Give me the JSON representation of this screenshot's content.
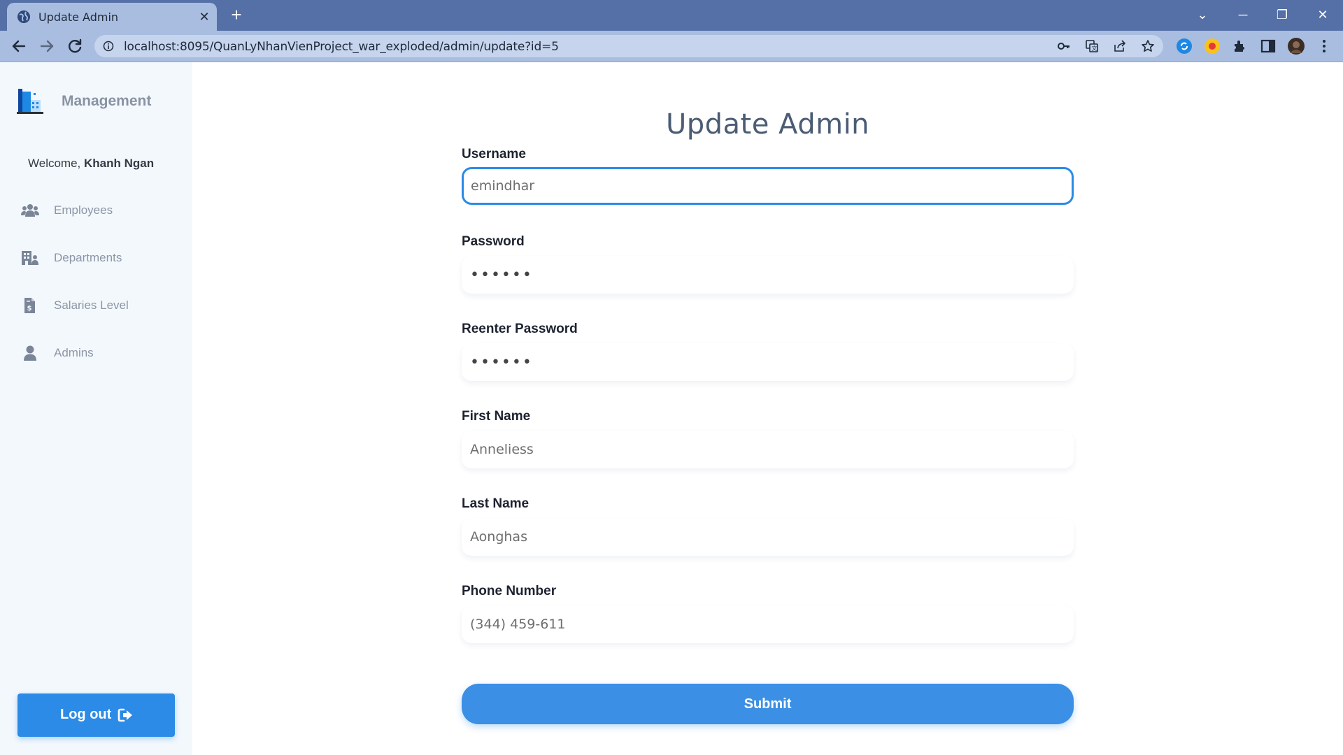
{
  "browser": {
    "tab_title": "Update Admin",
    "url": "localhost:8095/QuanLyNhanVienProject_war_exploded/admin/update?id=5",
    "icons": [
      "globe-icon",
      "close-icon",
      "plus-icon",
      "back-icon",
      "forward-icon",
      "reload-icon",
      "info-icon",
      "key-icon",
      "translate-icon",
      "share-icon",
      "star-icon",
      "extension-icon",
      "side-panel-icon",
      "avatar"
    ]
  },
  "sidebar": {
    "brand": "Management",
    "welcome_prefix": "Welcome, ",
    "welcome_name": "Khanh Ngan",
    "items": [
      {
        "label": "Employees",
        "icon": "users-icon"
      },
      {
        "label": "Departments",
        "icon": "building-icon"
      },
      {
        "label": "Salaries Level",
        "icon": "invoice-dollar-icon"
      },
      {
        "label": "Admins",
        "icon": "user-icon"
      }
    ],
    "logout_label": "Log out"
  },
  "form": {
    "title": "Update Admin",
    "fields": [
      {
        "label": "Username",
        "value": "emindhar"
      },
      {
        "label": "Password",
        "value": "••••••"
      },
      {
        "label": "Reenter Password",
        "value": "••••••"
      },
      {
        "label": "First Name",
        "value": "Anneliess"
      },
      {
        "label": "Last Name",
        "value": "Aonghas"
      },
      {
        "label": "Phone Number",
        "value": "(344) 459-611"
      }
    ],
    "submit_label": "Submit"
  },
  "colors": {
    "accent": "#2b8be6",
    "chrome": "#5470a6",
    "sidebar_bg": "#f3f8fd",
    "title": "#4b5c74"
  }
}
